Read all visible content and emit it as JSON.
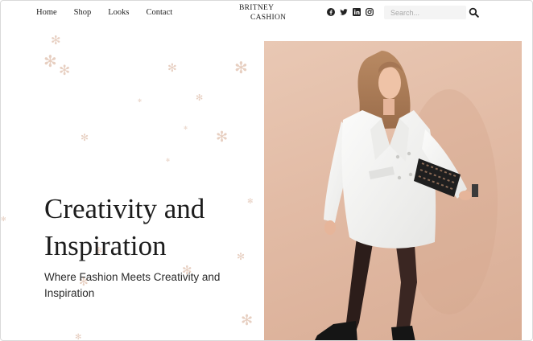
{
  "nav": {
    "items": [
      "Home",
      "Shop",
      "Looks",
      "Contact"
    ]
  },
  "logo": {
    "line1": "BRITNEY",
    "line2": "CASHION"
  },
  "social": [
    "facebook-icon",
    "twitter-icon",
    "linkedin-icon",
    "instagram-icon"
  ],
  "search": {
    "placeholder": "Search..."
  },
  "hero": {
    "title": "Creativity and Inspiration",
    "subtitle": "Where Fashion Meets Creativity and Inspiration"
  },
  "colors": {
    "snowflake": "#e7cfc1",
    "photo_bg": "#e2bba5",
    "coat": "#f4f4f2"
  }
}
